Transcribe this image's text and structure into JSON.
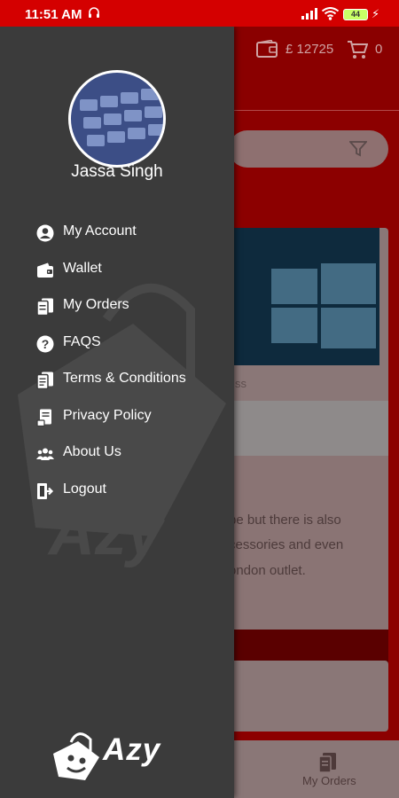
{
  "status_bar": {
    "time": "11:51 AM",
    "battery": "44"
  },
  "background": {
    "wallet_amount": "£ 12725",
    "cart_count": "0",
    "card_fragment": "ss",
    "description_lines": [
      "pe but there is also",
      "cessories and even",
      "ondon outlet."
    ],
    "bottom_nav_label": "My Orders"
  },
  "drawer": {
    "user_name": "Jassa Singh",
    "menu": [
      {
        "label": "My Account",
        "icon": "account-circle-icon"
      },
      {
        "label": "Wallet",
        "icon": "wallet-icon"
      },
      {
        "label": "My Orders",
        "icon": "orders-icon"
      },
      {
        "label": "FAQS",
        "icon": "help-circle-icon"
      },
      {
        "label": "Terms & Conditions",
        "icon": "terms-document-icon"
      },
      {
        "label": "Privacy Policy",
        "icon": "privacy-document-icon"
      },
      {
        "label": "About Us",
        "icon": "group-icon"
      },
      {
        "label": "Logout",
        "icon": "logout-icon"
      }
    ],
    "brand_name": "Azy"
  },
  "colors": {
    "status_red": "#d40000",
    "header_red": "#8a0000",
    "drawer_bg": "#3b3b3b"
  }
}
